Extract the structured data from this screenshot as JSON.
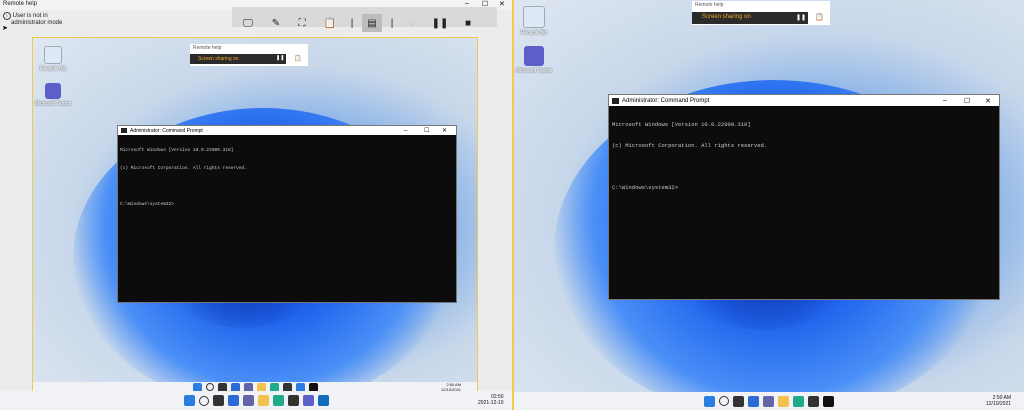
{
  "left_app": {
    "title": "Remote help",
    "status_line1": "User is not in",
    "status_line2": "administrator mode",
    "window_controls": [
      "–",
      "☐",
      "✕"
    ]
  },
  "left_screen": {
    "desktop_icons": [
      {
        "label": "Recycle Bin"
      },
      {
        "label": "Microsoft Teams"
      }
    ],
    "mini_remote_help": {
      "title": "Remote help",
      "status": "Screen sharing on"
    },
    "cmd": {
      "title": "Administrator: Command Prompt",
      "lines": [
        "Microsoft Windows [Version 10.0.22000.318]",
        "(c) Microsoft Corporation. All rights reserved.",
        "",
        "C:\\Windows\\system32>"
      ]
    },
    "inner_taskbar_clock": {
      "time": "2:50 AM",
      "date": "12/10/2021"
    },
    "outer_taskbar_clock": {
      "time": "02:50",
      "date": "2021-12-10"
    }
  },
  "right_screen": {
    "desktop_icons": [
      {
        "label": "Recycle Bin"
      },
      {
        "label": "Microsoft Teams"
      }
    ],
    "mini_remote_help": {
      "title": "Remote help",
      "status": "Screen sharing on"
    },
    "cmd": {
      "title": "Administrator: Command Prompt",
      "lines": [
        "Microsoft Windows [Version 10.0.22000.318]",
        "(c) Microsoft Corporation. All rights reserved.",
        "",
        "C:\\Windows\\system32>"
      ]
    },
    "taskbar_clock": {
      "time": "2:50 AM",
      "date": "12/10/2021"
    }
  },
  "colors": {
    "accent_orange": "#f5a623",
    "frame_yellow": "#f2c94c",
    "cmd_bg": "#0c0c0c"
  }
}
